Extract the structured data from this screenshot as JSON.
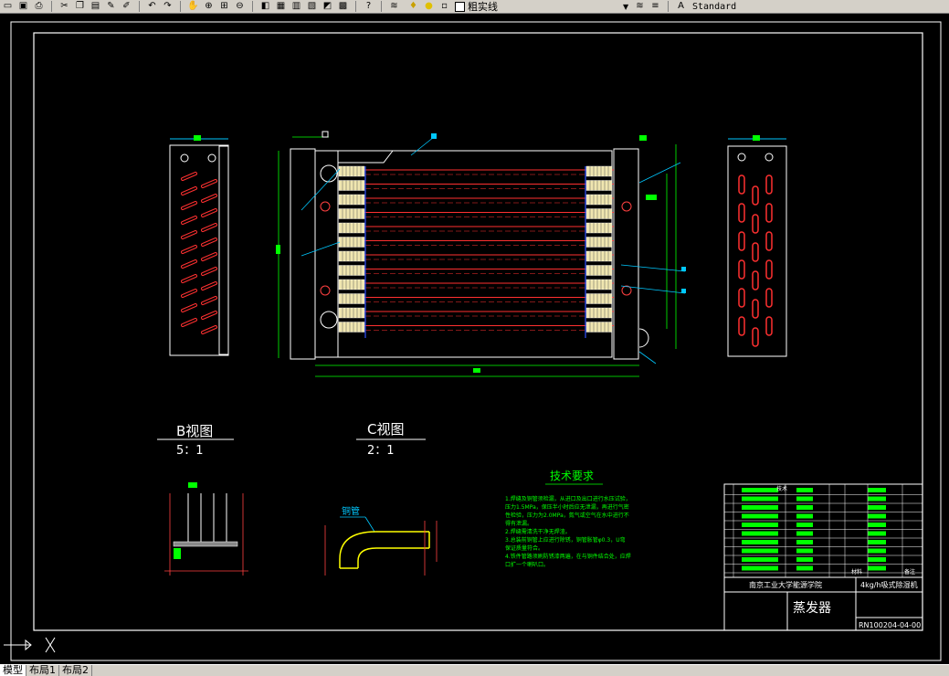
{
  "toolbar": {
    "icons": [
      "folder-icon",
      "save-icon",
      "print-icon",
      "cut-icon",
      "copy-icon",
      "paste-icon",
      "match-props-icon",
      "brush-icon",
      "undo-icon",
      "redo-icon",
      "pan-icon",
      "zoom-realtime-icon",
      "zoom-window-icon",
      "zoom-previous-icon",
      "properties-icon",
      "design-center-icon",
      "tool-palette-icon",
      "sheetset-icon",
      "markup-icon",
      "calculator-icon",
      "help-icon",
      "layer-manager-icon",
      "lightbulb-icon",
      "sun-icon",
      "lock-icon",
      "color-icon"
    ],
    "layer_name": "粗实线",
    "text_style": "Standard"
  },
  "drawing": {
    "view_b_title": "B视图",
    "view_b_scale": "5：1",
    "view_c_title": "C视图",
    "view_c_scale": "2：1",
    "tube_label": "铜管",
    "tech_title": "技术要求",
    "tech_lines": [
      "1.焊缝及铜管须检漏，从进口及出口进行水压试验，",
      "压力1.5MPa，保压半小时后应无泄漏，再进行气密",
      "性检验，压力为2.0MPa，氮气或空气在水中进行不",
      "得有泄漏。",
      "2.焊缝需清洗干净无焊渣。",
      "3.总装前铜管上应进行除锈，铜管胀管φ0.3，U弯",
      "保证质量符合。",
      "4.铁件管路须刷防锈漆两遍，在与铜件结合处，应焊",
      "口扩一个喇叭口。"
    ],
    "title_block": {
      "school": "南京工业大学能源学院",
      "product": "4kg/h吸式除湿机",
      "part_name": "蒸发器",
      "drawing_no": "RN100204-04-00",
      "material_col": "材料",
      "remark_col": "备注",
      "row_label": "技术"
    }
  },
  "status": {
    "tabs": [
      "模型",
      "布局1",
      "布局2"
    ]
  }
}
